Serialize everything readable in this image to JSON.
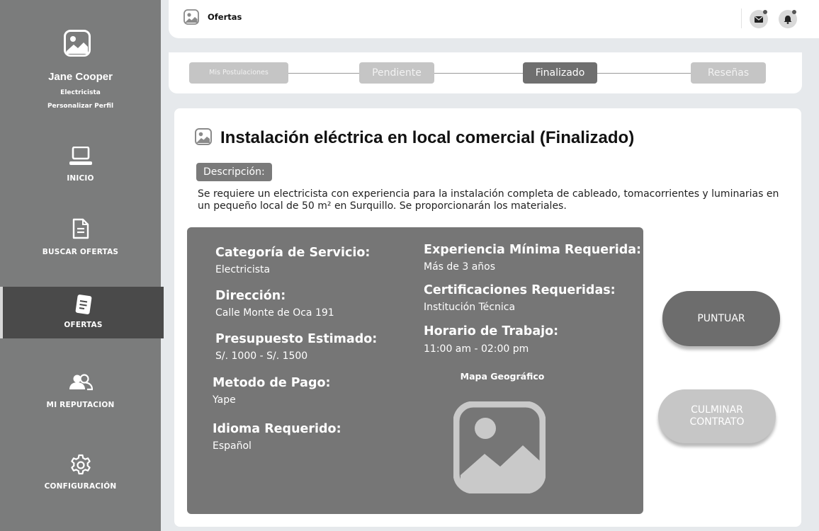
{
  "profile": {
    "name": "Jane Cooper",
    "role": "Electricista",
    "edit_link": "Personalizar Perfil"
  },
  "nav": [
    {
      "label": "INICIO",
      "icon": "laptop-icon"
    },
    {
      "label": "BUSCAR OFERTAS",
      "icon": "document-icon"
    },
    {
      "label": "OFERTAS",
      "icon": "notepad-icon",
      "active": true
    },
    {
      "label": "MI REPUTACION",
      "icon": "users-icon"
    },
    {
      "label": "CONFIGURACIÓN",
      "icon": "gear-icon"
    }
  ],
  "header": {
    "title": "Ofertas",
    "icons": [
      "mail-icon",
      "bell-icon"
    ]
  },
  "steps": [
    {
      "label": "Mis Postulaciones"
    },
    {
      "label": "Pendiente"
    },
    {
      "label": "Finalizado",
      "active": true
    },
    {
      "label": "Reseñas"
    }
  ],
  "offer": {
    "title": "Instalación eléctrica en local comercial (Finalizado)",
    "desc_label": "Descripción:",
    "description": "Se requiere un electricista con experiencia para la instalación completa de cableado, tomacorrientes y luminarias en un pequeño local de 50 m² en Surquillo. Se proporcionarán los materiales.",
    "fields": {
      "categoria": {
        "label": "Categoría de Servicio:",
        "value": "Electricista"
      },
      "direccion": {
        "label": "Dirección:",
        "value": "Calle Monte de Oca 191"
      },
      "presupuesto": {
        "label": "Presupuesto Estimado:",
        "value": "S/. 1000 - S/. 1500"
      },
      "pago": {
        "label": "Metodo de Pago:",
        "value": "Yape"
      },
      "idioma": {
        "label": "Idioma Requerido:",
        "value": "Español"
      },
      "experiencia": {
        "label": "Experiencia Mínima Requerida:",
        "value": "Más de 3 años"
      },
      "certificaciones": {
        "label": "Certificaciones Requeridas:",
        "value": "Institución Técnica"
      },
      "horario": {
        "label": "Horario de Trabajo:",
        "value": "11:00 am - 02:00 pm"
      }
    },
    "map_label": "Mapa Geográfico"
  },
  "actions": {
    "rate": "PUNTUAR",
    "finish": "CULMINAR\nCONTRATO"
  }
}
